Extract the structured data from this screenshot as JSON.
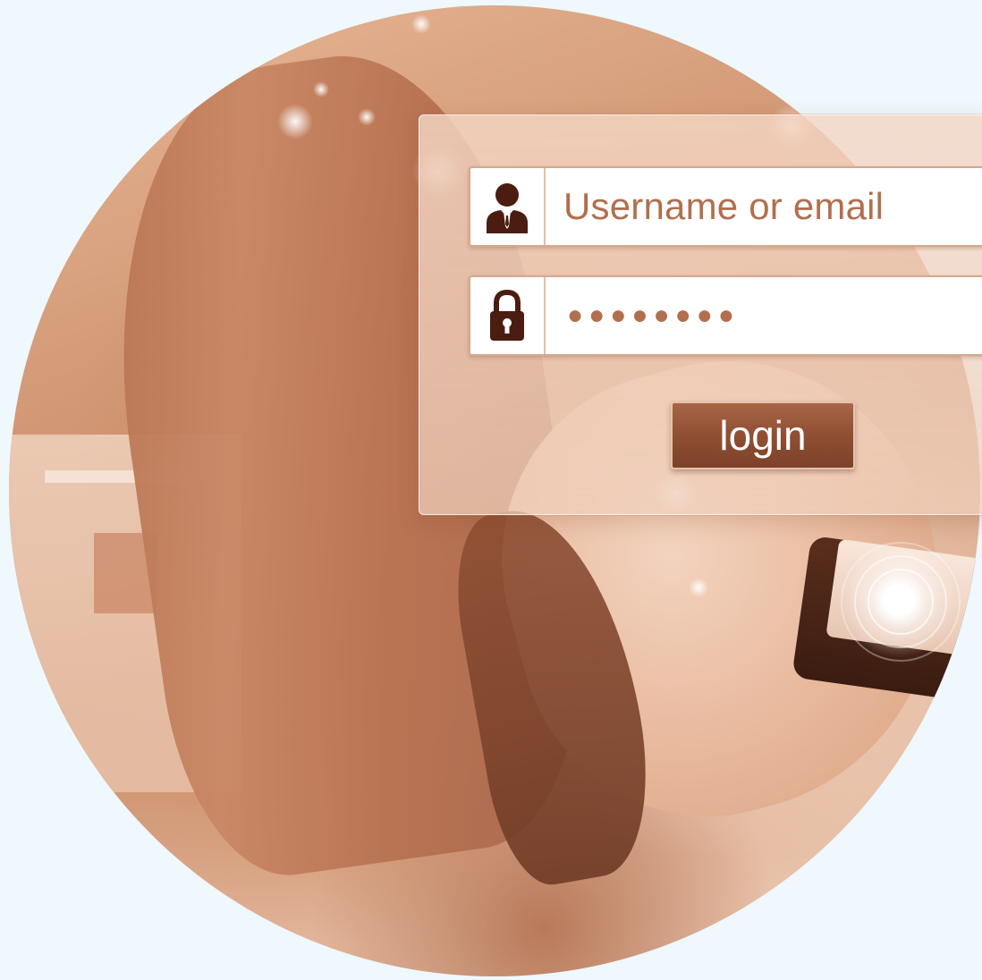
{
  "login_form": {
    "username_placeholder": "Username or email",
    "password_mask": "●●●●●●●●",
    "login_button_label": "login"
  },
  "icons": {
    "username": "user-icon",
    "password": "lock-icon"
  },
  "colors": {
    "page_background": "#eef8fd",
    "accent_brown": "#8f4f33",
    "placeholder_text": "#b16f4e",
    "button_text": "#ffffff"
  }
}
